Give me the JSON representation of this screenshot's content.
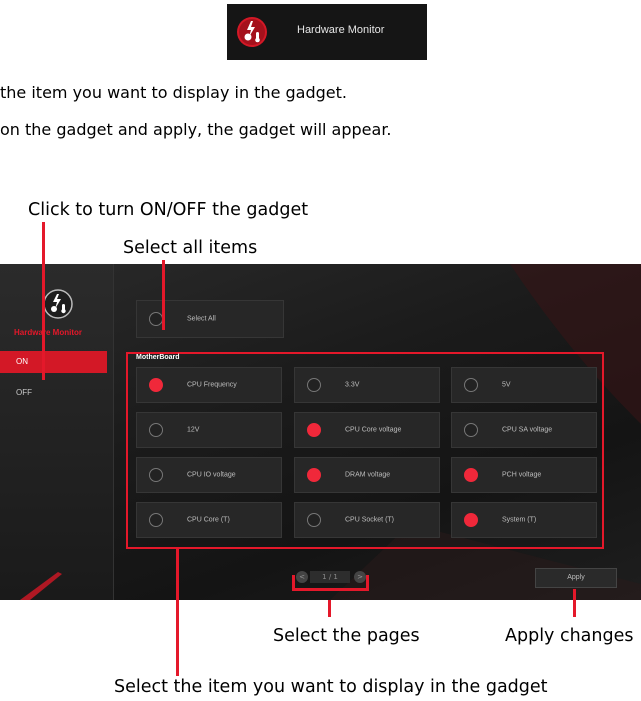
{
  "header": {
    "title": "Hardware Monitor",
    "icon": "hardware-monitor-icon"
  },
  "instructions": [
    "the item you want to display in the gadget.",
    "on the gadget and apply, the gadget will appear."
  ],
  "callouts": {
    "toggle": "Click to turn ON/OFF the gadget",
    "select_all": "Select all items",
    "pages": "Select the pages",
    "apply": "Apply changes",
    "items": "Select the item you want to display in the gadget"
  },
  "sidebar": {
    "title": "Hardware Monitor",
    "on_label": "ON",
    "off_label": "OFF"
  },
  "select_all_label": "Select All",
  "group_title": "MotherBoard",
  "items": [
    {
      "label": "CPU Frequency",
      "checked": true
    },
    {
      "label": "3.3V",
      "checked": false
    },
    {
      "label": "5V",
      "checked": false
    },
    {
      "label": "12V",
      "checked": false
    },
    {
      "label": "CPU Core voltage",
      "checked": true
    },
    {
      "label": "CPU SA voltage",
      "checked": false
    },
    {
      "label": "CPU IO voltage",
      "checked": false
    },
    {
      "label": "DRAM voltage",
      "checked": true
    },
    {
      "label": "PCH voltage",
      "checked": true
    },
    {
      "label": "CPU Core (T)",
      "checked": false
    },
    {
      "label": "CPU Socket (T)",
      "checked": false
    },
    {
      "label": "System (T)",
      "checked": true
    }
  ],
  "pager": {
    "text": "1 / 1",
    "prev": "<",
    "next": ">"
  },
  "apply_label": "Apply",
  "colors": {
    "accent": "#e4182a",
    "panel": "#1b1b1b"
  }
}
